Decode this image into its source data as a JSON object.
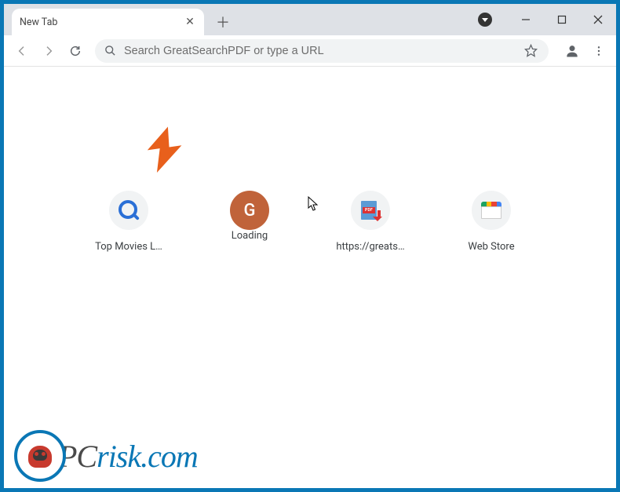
{
  "tab": {
    "title": "New Tab"
  },
  "omnibox": {
    "placeholder": "Search GreatSearchPDF or type a URL"
  },
  "shortcuts": [
    {
      "label": "Top Movies L…",
      "icon": "magnify"
    },
    {
      "label": "Loading",
      "icon": "g",
      "letter": "G"
    },
    {
      "label": "https://greats…",
      "icon": "pdf",
      "badge": "PDF"
    },
    {
      "label": "Web Store",
      "icon": "store"
    }
  ],
  "watermark": {
    "prefix": "PC",
    "suffix": "risk.com"
  }
}
